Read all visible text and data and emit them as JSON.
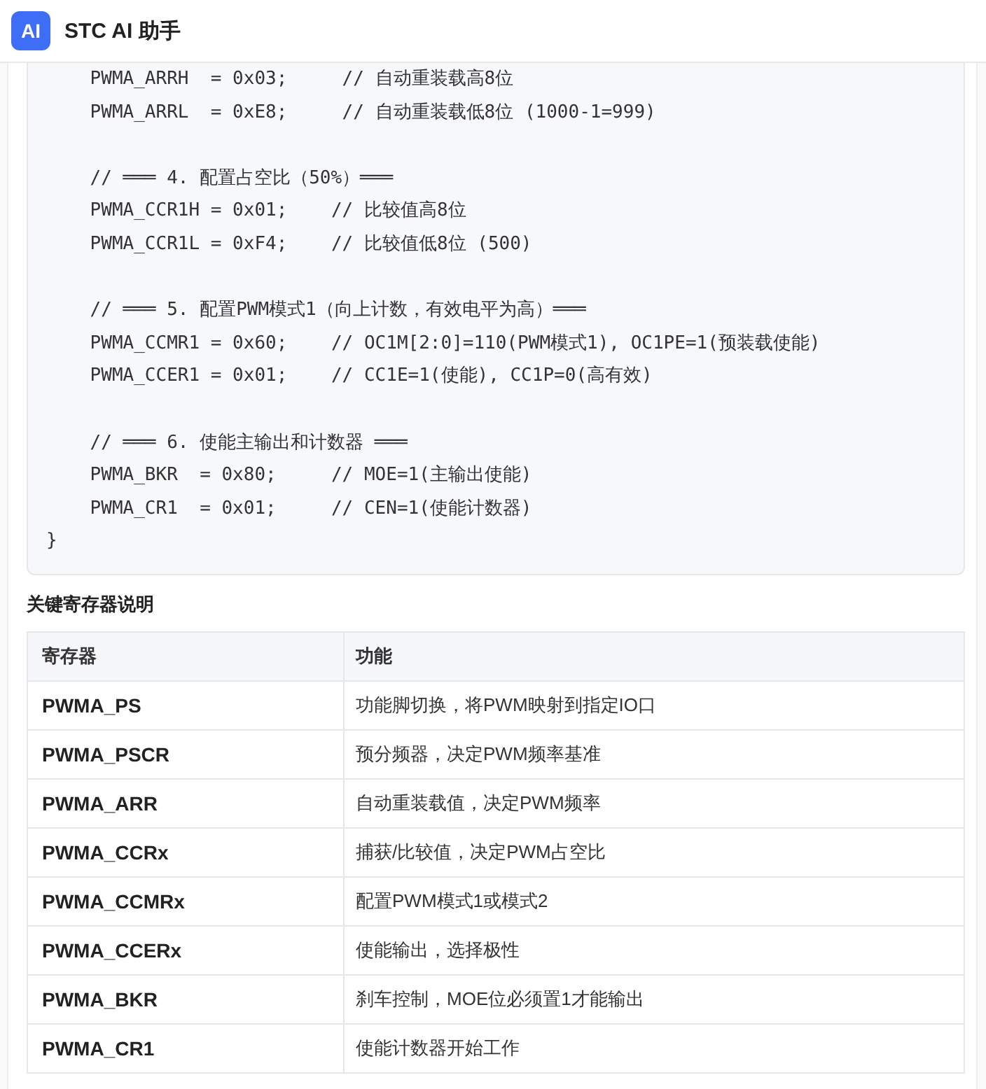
{
  "header": {
    "logo": "AI",
    "title": "STC AI 助手"
  },
  "code_block": {
    "body_groups": [
      [
        "PWMA_ARRH  = 0x03;     // 自动重装载高8位",
        "PWMA_ARRL  = 0xE8;     // 自动重装载低8位 (1000-1=999)"
      ],
      [
        "// ═══ 4. 配置占空比（50%）═══",
        "PWMA_CCR1H = 0x01;    // 比较值高8位",
        "PWMA_CCR1L = 0xF4;    // 比较值低8位 (500)"
      ],
      [
        "// ═══ 5. 配置PWM模式1（向上计数，有效电平为高）═══",
        "PWMA_CCMR1 = 0x60;    // OC1M[2:0]=110(PWM模式1), OC1PE=1(预装载使能)",
        "PWMA_CCER1 = 0x01;    // CC1E=1(使能), CC1P=0(高有效)"
      ],
      [
        "// ═══ 6. 使能主输出和计数器 ═══",
        "PWMA_BKR  = 0x80;     // MOE=1(主输出使能)",
        "PWMA_CR1  = 0x01;     // CEN=1(使能计数器)"
      ]
    ],
    "closing_brace": "}"
  },
  "section_title": "关键寄存器说明",
  "table": {
    "columns": [
      "寄存器",
      "功能"
    ],
    "rows": [
      [
        "PWMA_PS",
        "功能脚切换，将PWM映射到指定IO口"
      ],
      [
        "PWMA_PSCR",
        "预分频器，决定PWM频率基准"
      ],
      [
        "PWMA_ARR",
        "自动重装载值，决定PWM频率"
      ],
      [
        "PWMA_CCRx",
        "捕获/比较值，决定PWM占空比"
      ],
      [
        "PWMA_CCMRx",
        "配置PWM模式1或模式2"
      ],
      [
        "PWMA_CCERx",
        "使能输出，选择极性"
      ],
      [
        "PWMA_BKR",
        "刹车控制，MOE位必须置1才能输出"
      ],
      [
        "PWMA_CR1",
        "使能计数器开始工作"
      ]
    ]
  }
}
